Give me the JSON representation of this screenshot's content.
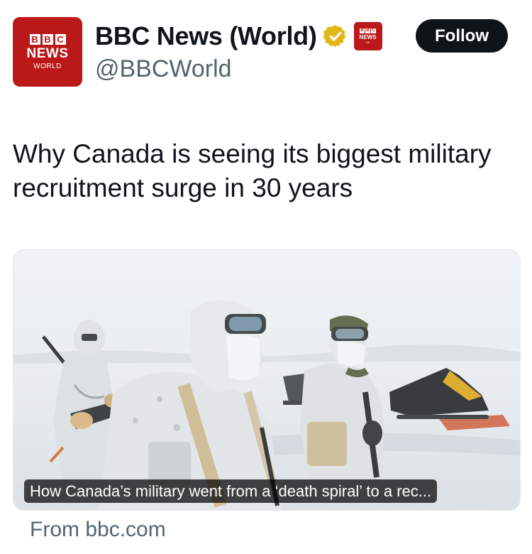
{
  "account": {
    "avatar": {
      "brand_letters": [
        "B",
        "B",
        "C"
      ],
      "news_label": "NEWS",
      "world_label": "WORLD"
    },
    "display_name": "BBC News (World)",
    "handle": "@BBCWorld",
    "verified_icon": "gold-check-badge-icon",
    "affiliate_badge": {
      "brand_letters": [
        "B",
        "B",
        "C"
      ],
      "news_label": "NEWS",
      "world_label": "UK"
    }
  },
  "follow_button": {
    "label": "Follow"
  },
  "tweet": {
    "text": "Why Canada is seeing its biggest military recruitment surge in 30 years"
  },
  "card": {
    "image_description_icon": "arctic-soldiers-photo",
    "caption": "How Canada’s military went from a ‘death spiral’ to a rec...",
    "source": "From bbc.com"
  },
  "colors": {
    "bbc_red": "#bb1919",
    "follow_bg": "#0f1419",
    "verified_gold": "#e2b719",
    "secondary_text": "#536471"
  }
}
